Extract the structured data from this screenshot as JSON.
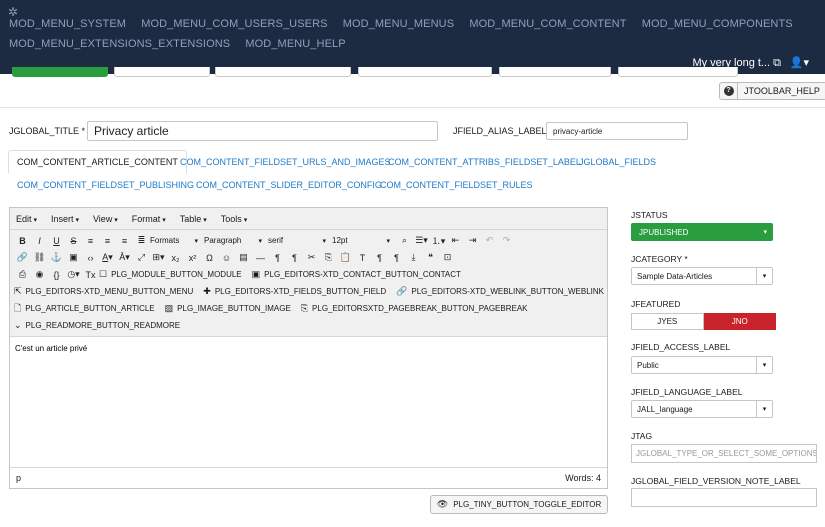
{
  "nav": {
    "row1": [
      "MOD_MENU_SYSTEM",
      "MOD_MENU_COM_USERS_USERS",
      "MOD_MENU_MENUS",
      "MOD_MENU_COM_CONTENT",
      "MOD_MENU_COMPONENTS"
    ],
    "row2": [
      "MOD_MENU_EXTENSIONS_EXTENSIONS",
      "MOD_MENU_HELP"
    ],
    "site_link": "My very long t... ⧉",
    "user_icon": "user-icon"
  },
  "toolbar": {
    "help_label": "JTOOLBAR_HELP"
  },
  "form": {
    "title_label": "JGLOBAL_TITLE *",
    "title_value": "Privacy article",
    "alias_label": "JFIELD_ALIAS_LABEL",
    "alias_value": "privacy-article"
  },
  "tabs": [
    "COM_CONTENT_ARTICLE_CONTENT",
    "COM_CONTENT_FIELDSET_URLS_AND_IMAGES",
    "COM_CONTENT_ATTRIBS_FIELDSET_LABEL",
    "JGLOBAL_FIELDS",
    "COM_CONTENT_FIELDSET_PUBLISHING",
    "COM_CONTENT_SLIDER_EDITOR_CONFIG",
    "COM_CONTENT_FIELDSET_RULES"
  ],
  "editor": {
    "menus": [
      "Edit",
      "Insert",
      "View",
      "Format",
      "Table",
      "Tools"
    ],
    "formats": "Formats",
    "paragraph": "Paragraph",
    "font": "serif",
    "size": "12pt",
    "plugins": [
      "PLG_MODULE_BUTTON_MODULE",
      "PLG_EDITORS-XTD_CONTACT_BUTTON_CONTACT",
      "PLG_EDITORS-XTD_MENU_BUTTON_MENU",
      "PLG_EDITORS-XTD_FIELDS_BUTTON_FIELD",
      "PLG_EDITORS-XTD_WEBLINK_BUTTON_WEBLINK",
      "PLG_ARTICLE_BUTTON_ARTICLE",
      "PLG_IMAGE_BUTTON_IMAGE",
      "PLG_EDITORSXTD_PAGEBREAK_BUTTON_PAGEBREAK",
      "PLG_READMORE_BUTTON_READMORE"
    ],
    "content": "C'est un article privé",
    "path": "p",
    "words": "Words: 4",
    "toggle_label": "PLG_TINY_BUTTON_TOGGLE_EDITOR"
  },
  "sidebar": {
    "status_label": "JSTATUS",
    "status_value": "JPUBLISHED",
    "category_label": "JCATEGORY *",
    "category_value": "Sample Data-Articles",
    "featured_label": "JFEATURED",
    "featured_yes": "JYES",
    "featured_no": "JNO",
    "access_label": "JFIELD_ACCESS_LABEL",
    "access_value": "Public",
    "language_label": "JFIELD_LANGUAGE_LABEL",
    "language_value": "JALL_language",
    "tag_label": "JTAG",
    "tag_placeholder": "JGLOBAL_TYPE_OR_SELECT_SOME_OPTIONS",
    "version_note_label": "JGLOBAL_FIELD_VERSION_NOTE_LABEL"
  },
  "colors": {
    "nav_bg": "#1c2b42",
    "published": "#2a9d3f",
    "no": "#c9242b",
    "link": "#1d7ac9"
  }
}
